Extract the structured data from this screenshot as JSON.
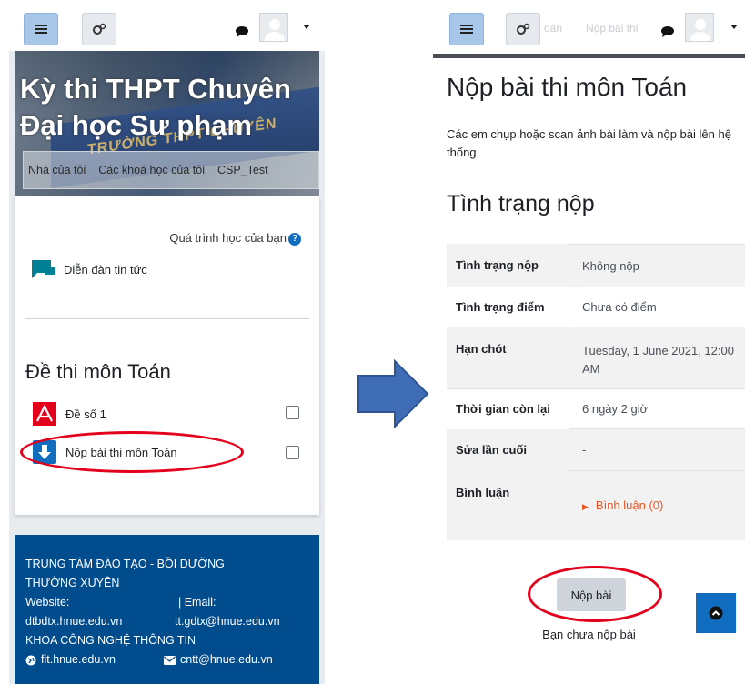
{
  "left": {
    "header": {
      "menu_icon": "hamburger-icon",
      "gear_icon": "gears-icon",
      "chat_icon": "speech-bubble-icon"
    },
    "hero": {
      "title": "Kỳ thi THPT Chuyên Đại học Sư phạm",
      "nav": [
        "Nhà của tôi",
        "Các khoá học của tôi",
        "CSP_Test"
      ]
    },
    "course": {
      "progress_label": "Quá trình học của bạn",
      "forum_label": "Diễn đàn tin tức",
      "section_title": "Đề thi môn Toán",
      "activities": [
        {
          "label": "Đề số 1",
          "icon": "pdf-icon"
        },
        {
          "label": "Nộp bài thi môn Toán",
          "icon": "assignment-upload-icon"
        }
      ]
    },
    "footer": {
      "line1": "TRUNG TÂM ĐÀO TẠO - BỒI DƯỠNG",
      "line2": "THƯỜNG XUYÊN",
      "website_label": "Website:",
      "email_label": "| Email:",
      "website": "dtbdtx.hnue.edu.vn",
      "email": "tt.gdtx@hnue.edu.vn",
      "line5": "KHOA CÔNG NGHỆ THÔNG TIN",
      "site2": "fit.hnue.edu.vn",
      "email2": "cntt@hnue.edu.vn"
    }
  },
  "right": {
    "header": {
      "faded_breadcrumb_1": "oán",
      "faded_breadcrumb_2": "Nộp bài thi"
    },
    "title": "Nộp bài thi môn Toán",
    "description": "Các em chụp hoặc scan ảnh bài làm và nộp bài lên hệ thống",
    "status_title": "Tình trạng nộp",
    "rows": [
      {
        "label": "Tình trạng nộp",
        "value": "Không nộp"
      },
      {
        "label": "Tình trạng điểm",
        "value": "Chưa có điểm"
      },
      {
        "label": "Hạn chót",
        "value": "Tuesday, 1 June 2021, 12:00 AM"
      },
      {
        "label": "Thời gian còn lại",
        "value": "6 ngày 2 giờ"
      },
      {
        "label": "Sửa lần cuối",
        "value": "-"
      },
      {
        "label": "Bình luận",
        "value": "Bình luận (0)"
      }
    ],
    "submit_label": "Nộp bài",
    "submit_status": "Bạn chưa nộp bài"
  },
  "colors": {
    "accent": "#0f6cbf",
    "footer_bg": "#004c8c",
    "highlight": "#e3001b",
    "comment_link": "#f0521d",
    "arrow": "#3f6db5"
  }
}
